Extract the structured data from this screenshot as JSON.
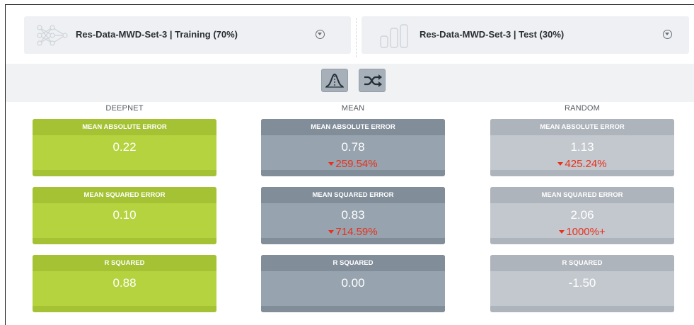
{
  "datasets": {
    "training": {
      "name": "Res-Data-MWD-Set-3 | Training (70%)",
      "icon": "network-graph-icon"
    },
    "test": {
      "name": "Res-Data-MWD-Set-3 | Test (30%)",
      "icon": "bar-columns-icon"
    }
  },
  "toolbar": {
    "buttons": [
      {
        "name": "distribution-icon"
      },
      {
        "name": "shuffle-icon"
      }
    ]
  },
  "colors": {
    "deepnet": "#b5d33f",
    "mean": "#97a3ae",
    "random": "#c3c8ce",
    "negative_delta": "#e8301c"
  },
  "columns": [
    {
      "label": "DEEPNET",
      "cards": [
        {
          "title": "MEAN ABSOLUTE ERROR",
          "value": "0.22",
          "delta": ""
        },
        {
          "title": "MEAN SQUARED ERROR",
          "value": "0.10",
          "delta": ""
        },
        {
          "title": "R SQUARED",
          "value": "0.88",
          "delta": ""
        }
      ]
    },
    {
      "label": "MEAN",
      "cards": [
        {
          "title": "MEAN ABSOLUTE ERROR",
          "value": "0.78",
          "delta": "259.54%"
        },
        {
          "title": "MEAN SQUARED ERROR",
          "value": "0.83",
          "delta": "714.59%"
        },
        {
          "title": "R SQUARED",
          "value": "0.00",
          "delta": ""
        }
      ]
    },
    {
      "label": "RANDOM",
      "cards": [
        {
          "title": "MEAN ABSOLUTE ERROR",
          "value": "1.13",
          "delta": "425.24%"
        },
        {
          "title": "MEAN SQUARED ERROR",
          "value": "2.06",
          "delta": "1000%+"
        },
        {
          "title": "R SQUARED",
          "value": "-1.50",
          "delta": ""
        }
      ]
    }
  ]
}
